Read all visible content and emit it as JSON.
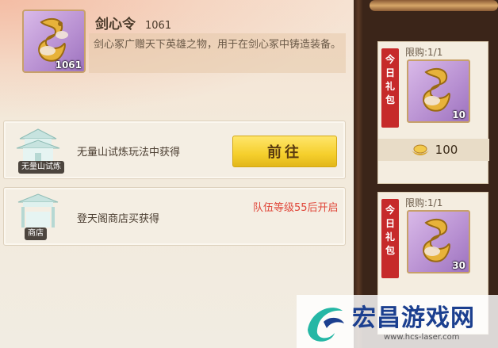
{
  "item": {
    "name": "剑心令",
    "quantity": "1061",
    "count_badge": "1061",
    "description": "剑心冢广赠天下英雄之物，用于在剑心冢中铸造装备。",
    "icon": "golden-dragon-icon"
  },
  "sources": [
    {
      "tag": "无量山试炼",
      "text": "无量山试炼玩法中获得",
      "button_label": "前往",
      "icon": "pavilion-icon"
    },
    {
      "tag": "商店",
      "text": "登天阁商店买获得",
      "locked_text": "队伍等级55后开启",
      "icon": "pavilion-icon"
    }
  ],
  "packs": [
    {
      "ribbon": "今日礼包",
      "limit": "限购:1/1",
      "count": "10",
      "price": "100",
      "icon": "golden-dragon-icon",
      "currency_icon": "gold-ingot-icon"
    },
    {
      "ribbon": "今日礼包",
      "limit": "限购:1/1",
      "count": "30",
      "icon": "golden-dragon-icon"
    }
  ],
  "watermark": {
    "text": "宏昌游戏网",
    "url": "www.hcs-laser.com"
  },
  "colors": {
    "accent_gold": "#f5cf2c",
    "locked_red": "#e0473a",
    "ribbon_red": "#c62a2a",
    "item_purple": "#b78fd1"
  }
}
